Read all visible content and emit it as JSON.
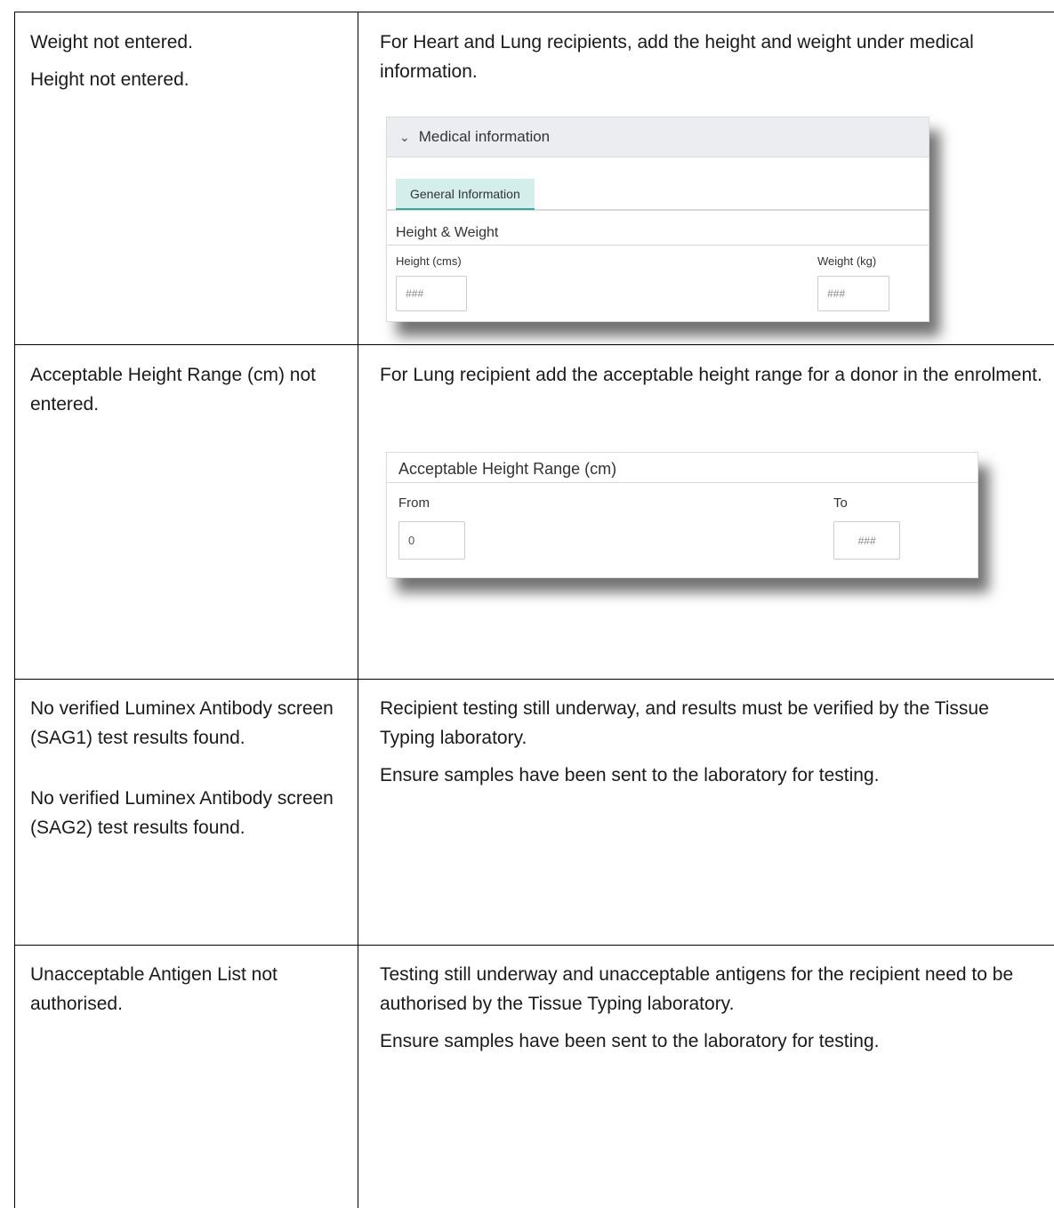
{
  "rows": [
    {
      "issue": [
        "Weight not entered.",
        "Height not entered."
      ],
      "action": [
        "For Heart and Lung recipients, add the height and weight under medical information."
      ]
    },
    {
      "issue": [
        "Acceptable Height Range (cm) not entered."
      ],
      "action": [
        "For Lung recipient add the acceptable height range for a donor in the enrolment."
      ]
    },
    {
      "issue": [
        "No verified Luminex Antibody screen (SAG1) test results found.",
        "No verified Luminex Antibody screen (SAG2) test results found."
      ],
      "action": [
        "Recipient testing still underway, and results must be verified by the Tissue Typing laboratory.",
        "Ensure samples have been sent to the laboratory for testing."
      ]
    },
    {
      "issue": [
        "Unacceptable Antigen List not authorised."
      ],
      "action": [
        "Testing still underway and unacceptable antigens for the recipient need to be authorised by the Tissue Typing laboratory.",
        "Ensure samples have been sent to the laboratory for testing."
      ]
    }
  ],
  "medical_panel": {
    "header": "Medical information",
    "tab": "General Information",
    "section": "Height & Weight",
    "height_label": "Height (cms)",
    "weight_label": "Weight (kg)",
    "height_placeholder": "###",
    "weight_placeholder": "###"
  },
  "range_panel": {
    "title": "Acceptable Height Range (cm)",
    "from_label": "From",
    "to_label": "To",
    "from_value": "0",
    "to_placeholder": "###"
  }
}
